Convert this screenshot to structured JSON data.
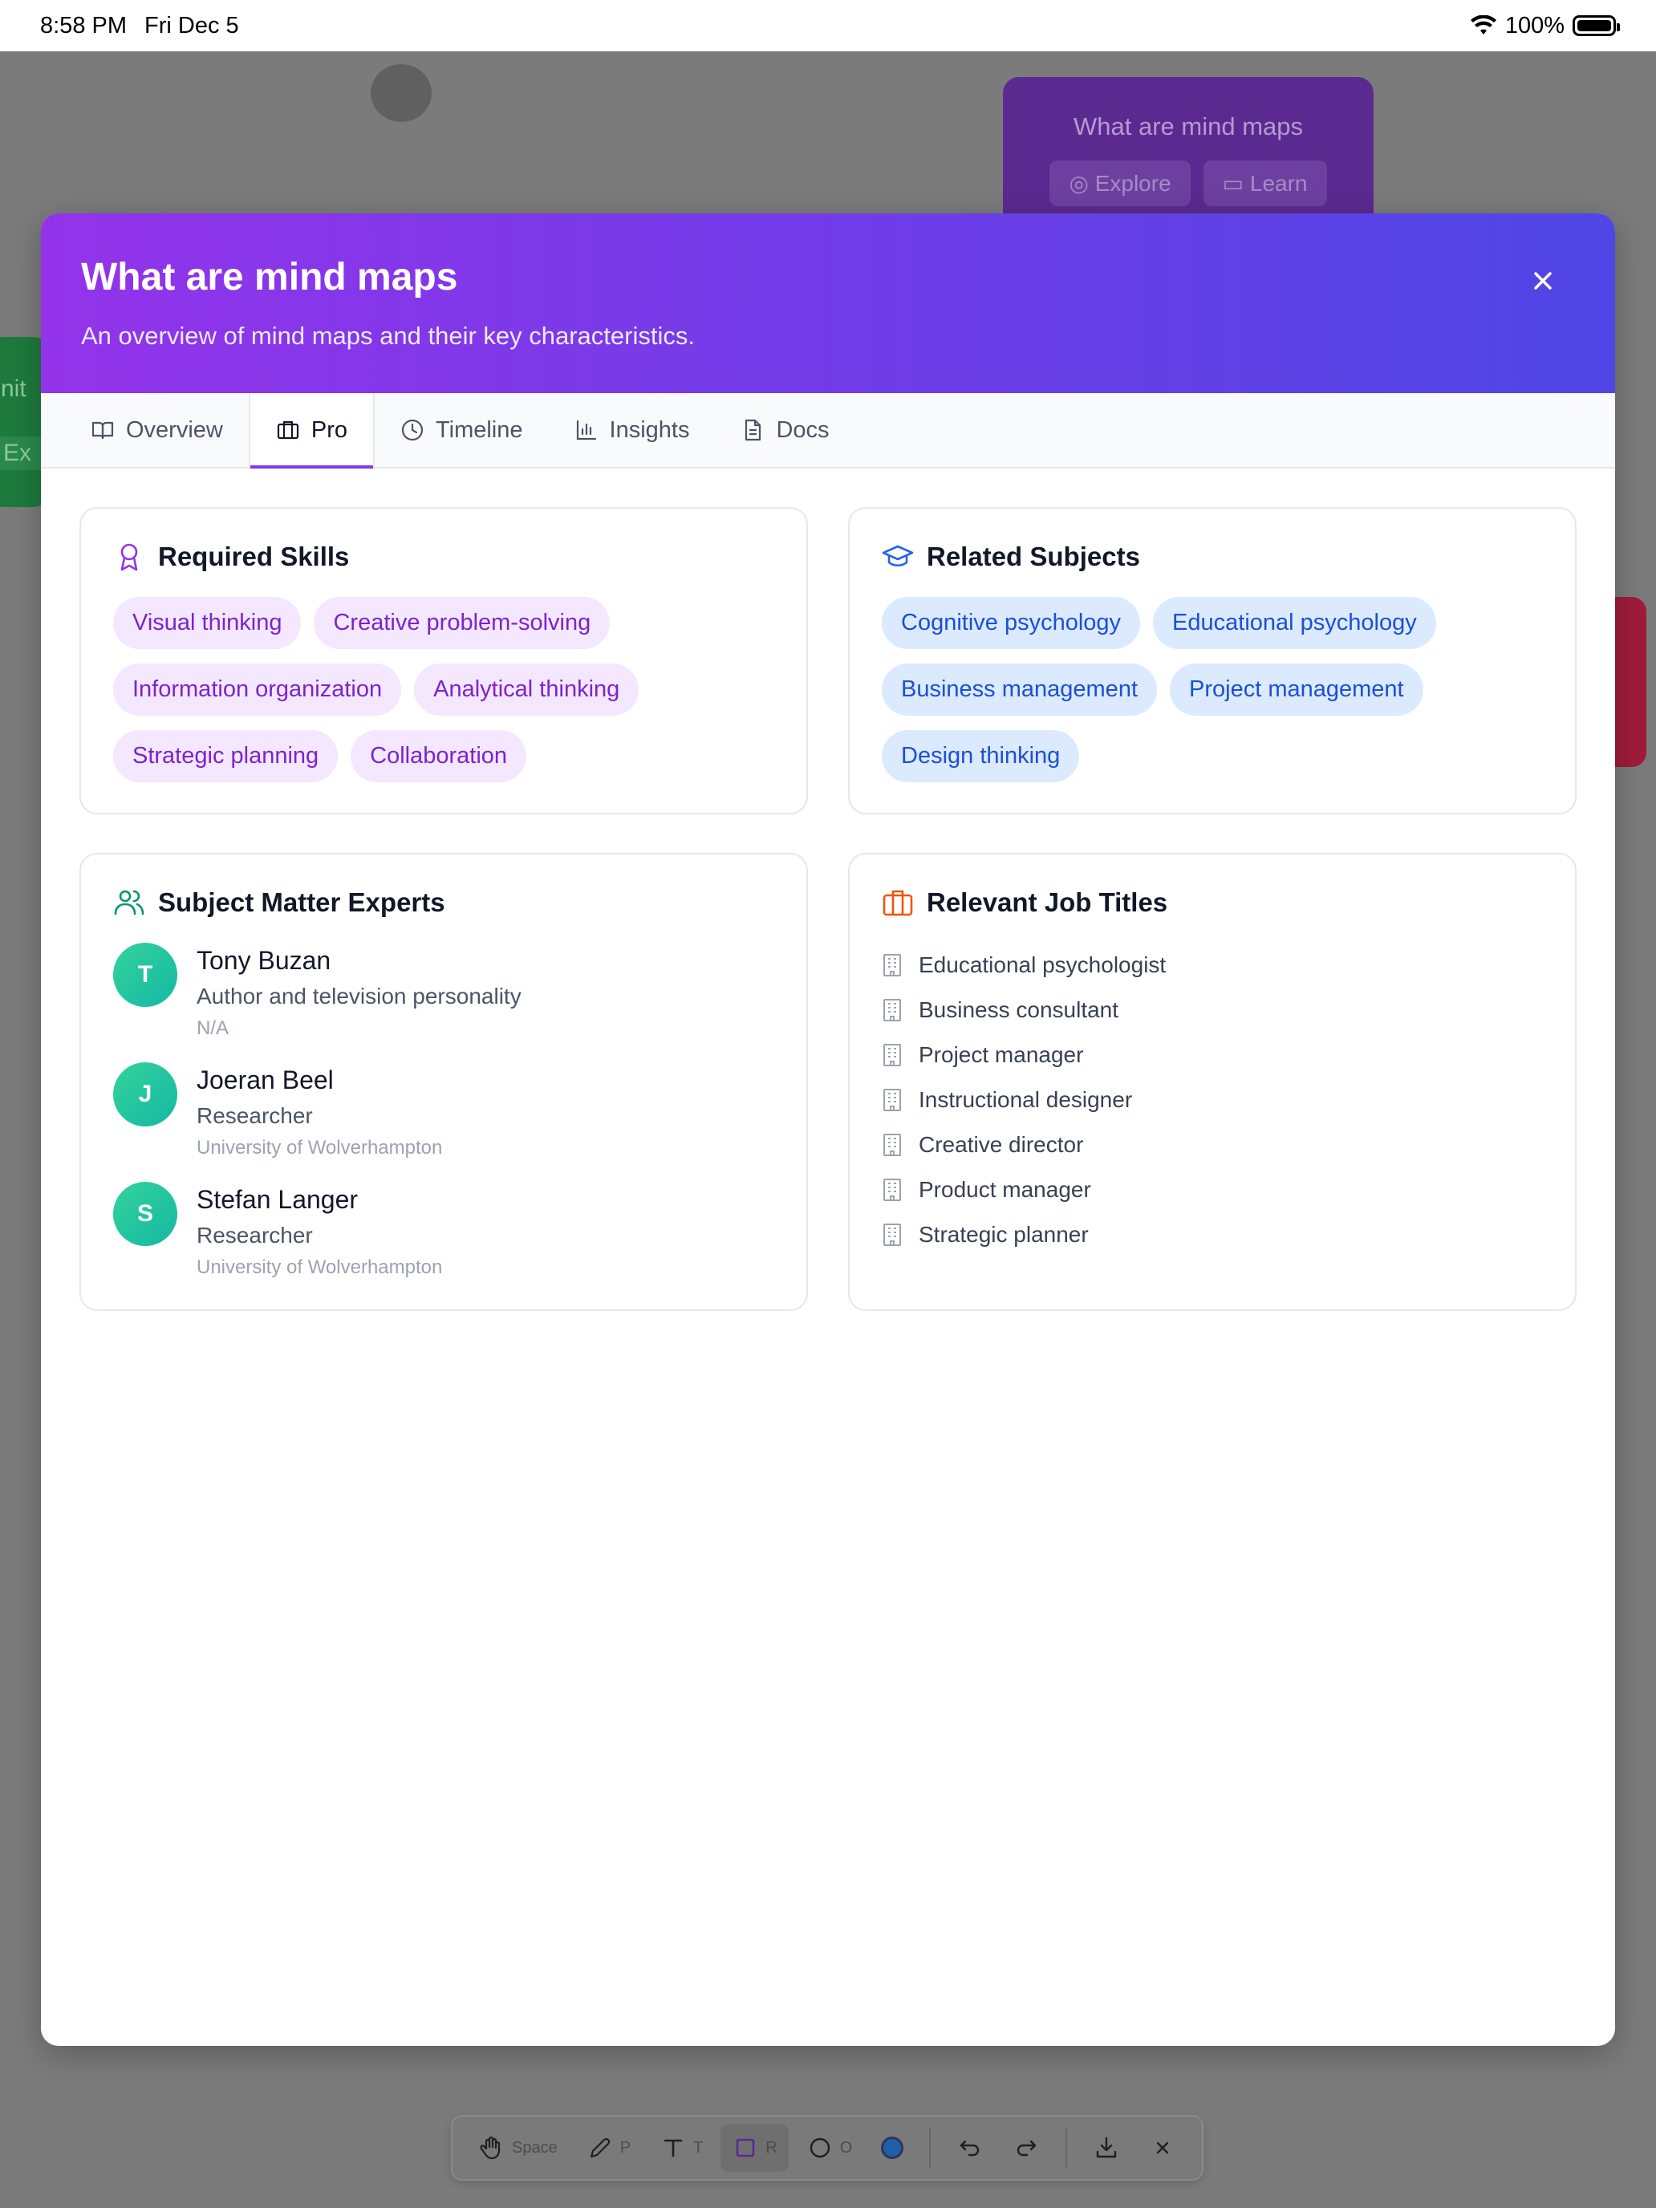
{
  "status_bar": {
    "time": "8:58 PM",
    "date": "Fri Dec 5",
    "battery": "100%"
  },
  "background": {
    "node_title": "What are mind maps",
    "node_explore": "Explore",
    "node_learn": "Learn",
    "green_node_text": "finit",
    "green_node_button": "Ex"
  },
  "modal": {
    "title": "What are mind maps",
    "subtitle": "An overview of mind maps and their key characteristics.",
    "close_label": "×"
  },
  "tabs": [
    {
      "label": "Overview",
      "icon": "book-icon"
    },
    {
      "label": "Pro",
      "icon": "briefcase-icon"
    },
    {
      "label": "Timeline",
      "icon": "clock-icon"
    },
    {
      "label": "Insights",
      "icon": "bar-chart-icon"
    },
    {
      "label": "Docs",
      "icon": "document-icon"
    }
  ],
  "active_tab": "Pro",
  "skills": {
    "title": "Required Skills",
    "items": [
      "Visual thinking",
      "Creative problem-solving",
      "Information organization",
      "Analytical thinking",
      "Strategic planning",
      "Collaboration"
    ]
  },
  "subjects": {
    "title": "Related Subjects",
    "items": [
      "Cognitive psychology",
      "Educational psychology",
      "Business management",
      "Project management",
      "Design thinking"
    ]
  },
  "experts": {
    "title": "Subject Matter Experts",
    "items": [
      {
        "initial": "T",
        "name": "Tony Buzan",
        "role": "Author and television personality",
        "org": "N/A"
      },
      {
        "initial": "J",
        "name": "Joeran Beel",
        "role": "Researcher",
        "org": "University of Wolverhampton"
      },
      {
        "initial": "S",
        "name": "Stefan Langer",
        "role": "Researcher",
        "org": "University of Wolverhampton"
      }
    ]
  },
  "jobs": {
    "title": "Relevant Job Titles",
    "items": [
      "Educational psychologist",
      "Business consultant",
      "Project manager",
      "Instructional designer",
      "Creative director",
      "Product manager",
      "Strategic planner"
    ]
  },
  "toolbar": {
    "pan_key": "Space",
    "pen_key": "P",
    "text_key": "T",
    "rect_key": "R",
    "ellipse_key": "O",
    "color": "#1f5fa8"
  },
  "colors": {
    "header_start": "#9333ea",
    "header_end": "#4f46e5",
    "skill_chip_bg": "#f3e8ff",
    "subject_chip_bg": "#dbeafe",
    "avatar": "#14b8a6"
  }
}
